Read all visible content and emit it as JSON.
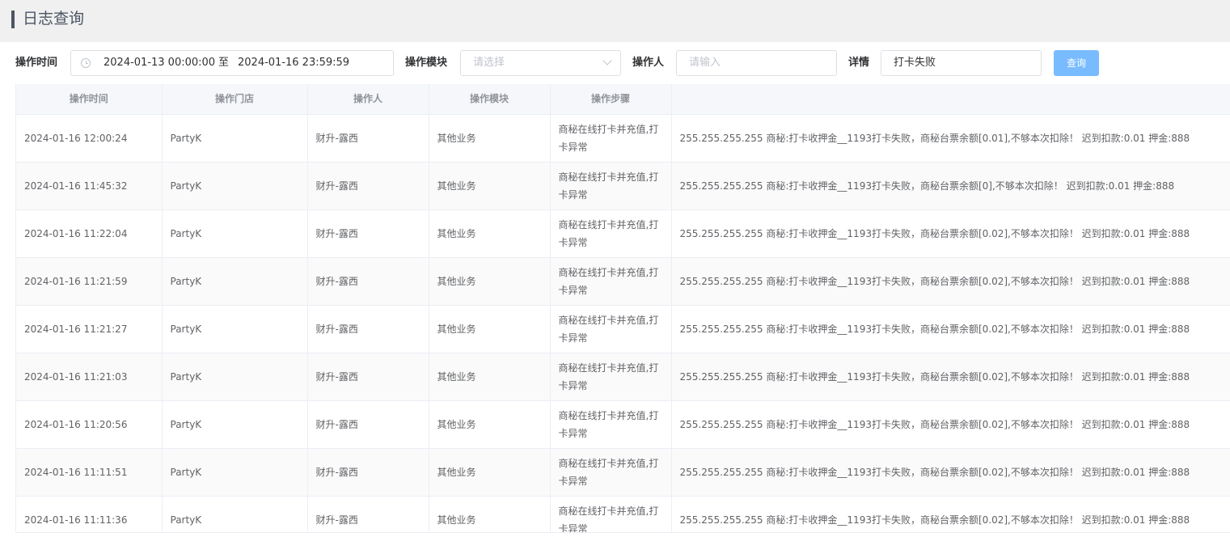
{
  "header": {
    "title": "日志查询"
  },
  "filters": {
    "time_label": "操作时间",
    "time_start": "2024-01-13 00:00:00",
    "time_sep": "至",
    "time_end": "2024-01-16 23:59:59",
    "module_label": "操作模块",
    "module_placeholder": "请选择",
    "operator_label": "操作人",
    "operator_placeholder": "请输入",
    "detail_label": "详情",
    "detail_value": "打卡失败",
    "query_button": "查询"
  },
  "table": {
    "columns": [
      "操作时间",
      "操作门店",
      "操作人",
      "操作模块",
      "操作步骤",
      ""
    ],
    "rows": [
      {
        "time": "2024-01-16 12:00:24",
        "store": "PartyK",
        "operator": "财升-露西",
        "module": "其他业务",
        "step": "商秘在线打卡并充值,打卡异常",
        "detail": "255.255.255.255 商秘:打卡收押金__1193打卡失败，商秘台票余额[0.01],不够本次扣除！ 迟到扣款:0.01 押金:888"
      },
      {
        "time": "2024-01-16 11:45:32",
        "store": "PartyK",
        "operator": "财升-露西",
        "module": "其他业务",
        "step": "商秘在线打卡并充值,打卡异常",
        "detail": "255.255.255.255 商秘:打卡收押金__1193打卡失败，商秘台票余额[0],不够本次扣除！ 迟到扣款:0.01 押金:888"
      },
      {
        "time": "2024-01-16 11:22:04",
        "store": "PartyK",
        "operator": "财升-露西",
        "module": "其他业务",
        "step": "商秘在线打卡并充值,打卡异常",
        "detail": "255.255.255.255 商秘:打卡收押金__1193打卡失败，商秘台票余额[0.02],不够本次扣除！ 迟到扣款:0.01 押金:888"
      },
      {
        "time": "2024-01-16 11:21:59",
        "store": "PartyK",
        "operator": "财升-露西",
        "module": "其他业务",
        "step": "商秘在线打卡并充值,打卡异常",
        "detail": "255.255.255.255 商秘:打卡收押金__1193打卡失败，商秘台票余额[0.02],不够本次扣除！ 迟到扣款:0.01 押金:888"
      },
      {
        "time": "2024-01-16 11:21:27",
        "store": "PartyK",
        "operator": "财升-露西",
        "module": "其他业务",
        "step": "商秘在线打卡并充值,打卡异常",
        "detail": "255.255.255.255 商秘:打卡收押金__1193打卡失败，商秘台票余额[0.02],不够本次扣除！ 迟到扣款:0.01 押金:888"
      },
      {
        "time": "2024-01-16 11:21:03",
        "store": "PartyK",
        "operator": "财升-露西",
        "module": "其他业务",
        "step": "商秘在线打卡并充值,打卡异常",
        "detail": "255.255.255.255 商秘:打卡收押金__1193打卡失败，商秘台票余额[0.02],不够本次扣除！ 迟到扣款:0.01 押金:888"
      },
      {
        "time": "2024-01-16 11:20:56",
        "store": "PartyK",
        "operator": "财升-露西",
        "module": "其他业务",
        "step": "商秘在线打卡并充值,打卡异常",
        "detail": "255.255.255.255 商秘:打卡收押金__1193打卡失败，商秘台票余额[0.02],不够本次扣除！ 迟到扣款:0.01 押金:888"
      },
      {
        "time": "2024-01-16 11:11:51",
        "store": "PartyK",
        "operator": "财升-露西",
        "module": "其他业务",
        "step": "商秘在线打卡并充值,打卡异常",
        "detail": "255.255.255.255 商秘:打卡收押金__1193打卡失败，商秘台票余额[0.02],不够本次扣除！ 迟到扣款:0.01 押金:888"
      },
      {
        "time": "2024-01-16 11:11:36",
        "store": "PartyK",
        "operator": "财升-露西",
        "module": "其他业务",
        "step": "商秘在线打卡并充值,打卡异常",
        "detail": "255.255.255.255 商秘:打卡收押金__1193打卡失败，商秘台票余额[0.02],不够本次扣除！ 迟到扣款:0.01 押金:888"
      }
    ]
  },
  "colors": {
    "accent": "#79bbff",
    "header_bg": "#f0f0f0",
    "title_bar": "#4a5563"
  },
  "icons": {
    "time_picker": "clock-icon",
    "select": "chevron-down-icon"
  }
}
